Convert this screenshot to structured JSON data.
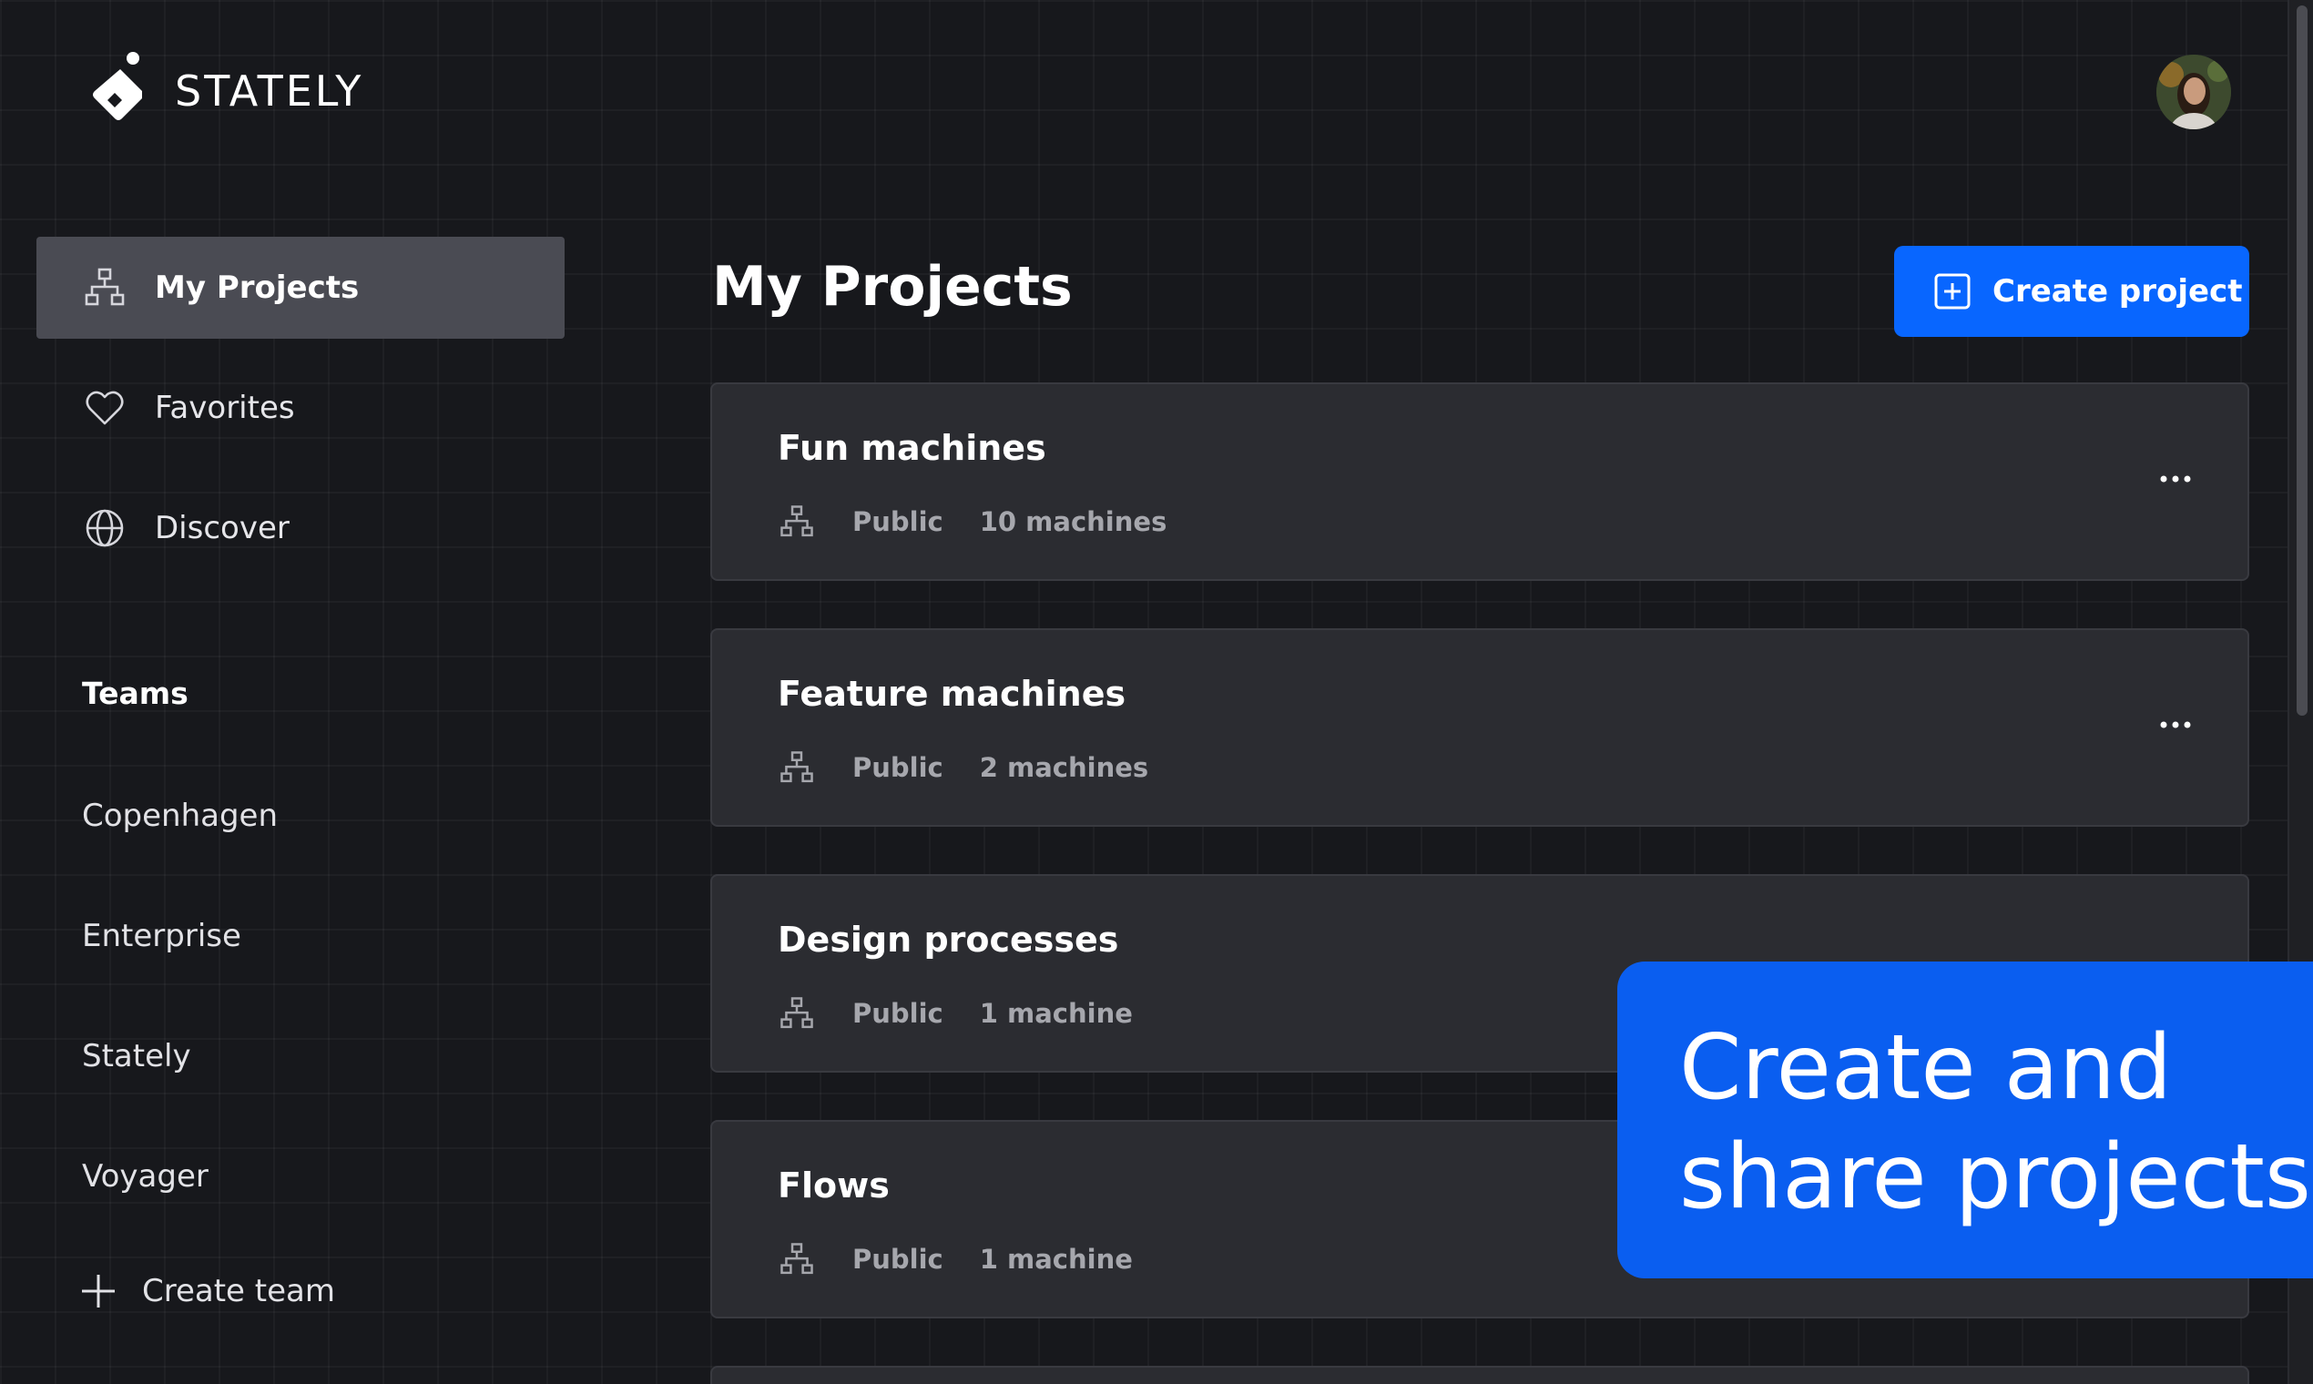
{
  "brand": {
    "name": "STATELY"
  },
  "sidebar": {
    "nav": [
      {
        "label": "My Projects",
        "icon": "hierarchy-icon",
        "active": true
      },
      {
        "label": "Favorites",
        "icon": "heart-icon",
        "active": false
      },
      {
        "label": "Discover",
        "icon": "globe-icon",
        "active": false
      }
    ],
    "teams_heading": "Teams",
    "teams": [
      "Copenhagen",
      "Enterprise",
      "Stately",
      "Voyager"
    ],
    "create_team_label": "Create team"
  },
  "main": {
    "title": "My Projects",
    "create_project_label": "Create project",
    "projects": [
      {
        "name": "Fun machines",
        "visibility": "Public",
        "count": "10 machines"
      },
      {
        "name": "Feature machines",
        "visibility": "Public",
        "count": "2 machines"
      },
      {
        "name": "Design processes",
        "visibility": "Public",
        "count": "1 machine"
      },
      {
        "name": "Flows",
        "visibility": "Public",
        "count": "1 machine"
      }
    ]
  },
  "promo": {
    "line1": "Create and",
    "line2": "share projects"
  },
  "colors": {
    "background": "#17181c",
    "accent": "#0866ff",
    "card": "#2b2c31",
    "active_nav": "#4a4b53"
  }
}
